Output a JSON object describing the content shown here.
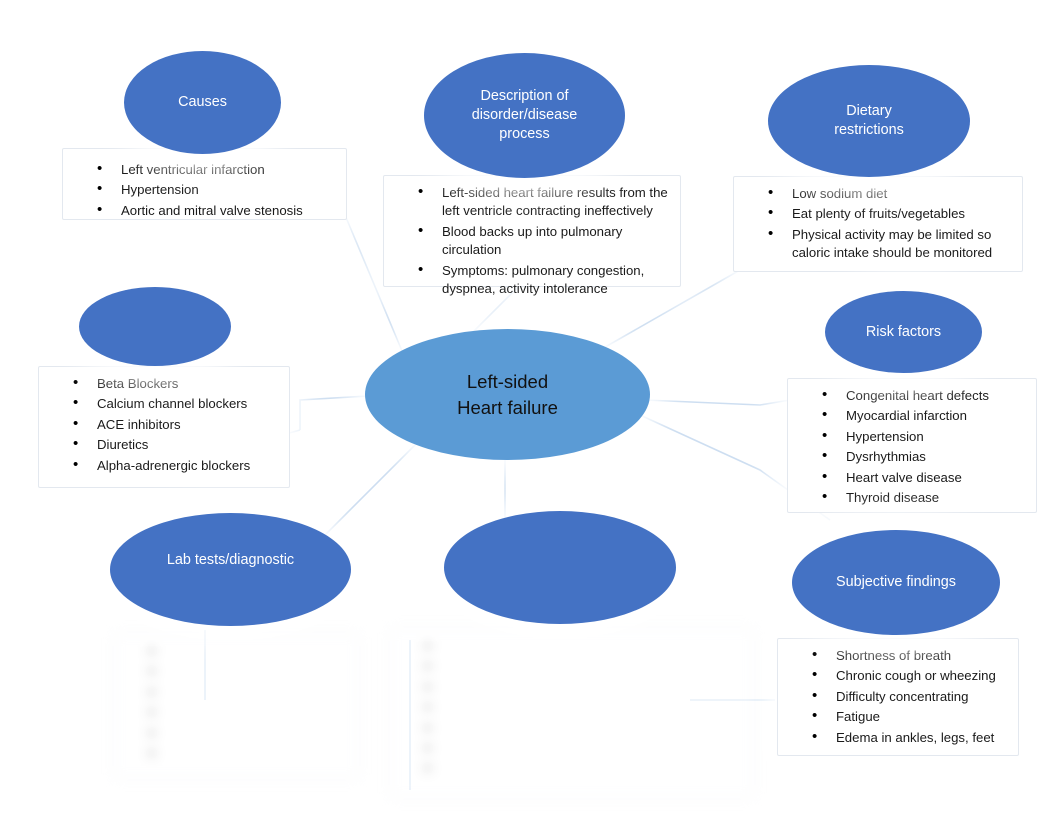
{
  "diagram": {
    "title": "Left-sided Heart Failure concept map",
    "colors": {
      "node_blue": "#4472C4",
      "center_blue": "#5B9BD5",
      "connector": "#BBD2EA",
      "box_border": "#E3E8EF",
      "text_dark": "#1A1A1A",
      "text_light": "#FFFFFF"
    }
  },
  "center": {
    "line1": "Left-sided",
    "line2": "Heart failure"
  },
  "nodes": {
    "causes": {
      "title": "Causes",
      "items": [
        "Left ventricular infarction",
        "Hypertension",
        "Aortic and mitral valve stenosis"
      ]
    },
    "description": {
      "title_line1": "Description of",
      "title_line2": "disorder/disease",
      "title_line3": "process",
      "items": [
        "Left-sided heart failure results from the left ventricle contracting ineffectively",
        "Blood backs up into pulmonary circulation",
        "Symptoms: pulmonary congestion, dyspnea, activity intolerance"
      ]
    },
    "dietary": {
      "title_line1": "Dietary",
      "title_line2": "restrictions",
      "items": [
        "Low sodium diet",
        "Eat plenty of fruits/vegetables",
        "Physical activity may be limited so caloric intake should be monitored"
      ]
    },
    "medications": {
      "title": "",
      "title_state": "blurred",
      "items": [
        "Beta Blockers",
        "Calcium channel blockers",
        "ACE inhibitors",
        "Diuretics",
        "Alpha-adrenergic blockers"
      ]
    },
    "risk_factors": {
      "title": "Risk factors",
      "items": [
        "Congenital heart defects",
        "Myocardial infarction",
        "Hypertension",
        "Dysrhythmias",
        "Heart valve disease",
        "Thyroid disease"
      ]
    },
    "lab_tests": {
      "title_line1": "Lab tests/diagnostic",
      "title_line2": "",
      "title_line2_state": "blurred",
      "items_state": "blurred",
      "items": [
        "",
        "",
        "",
        "",
        "",
        ""
      ]
    },
    "bottom_center": {
      "title": "",
      "title_state": "blurred",
      "items_state": "blurred",
      "items": [
        "",
        "",
        "",
        "",
        "",
        "",
        ""
      ]
    },
    "subjective": {
      "title": "Subjective findings",
      "items": [
        "Shortness of breath",
        "Chronic cough or wheezing",
        "Difficulty concentrating",
        "Fatigue",
        "Edema in ankles, legs, feet"
      ]
    }
  }
}
